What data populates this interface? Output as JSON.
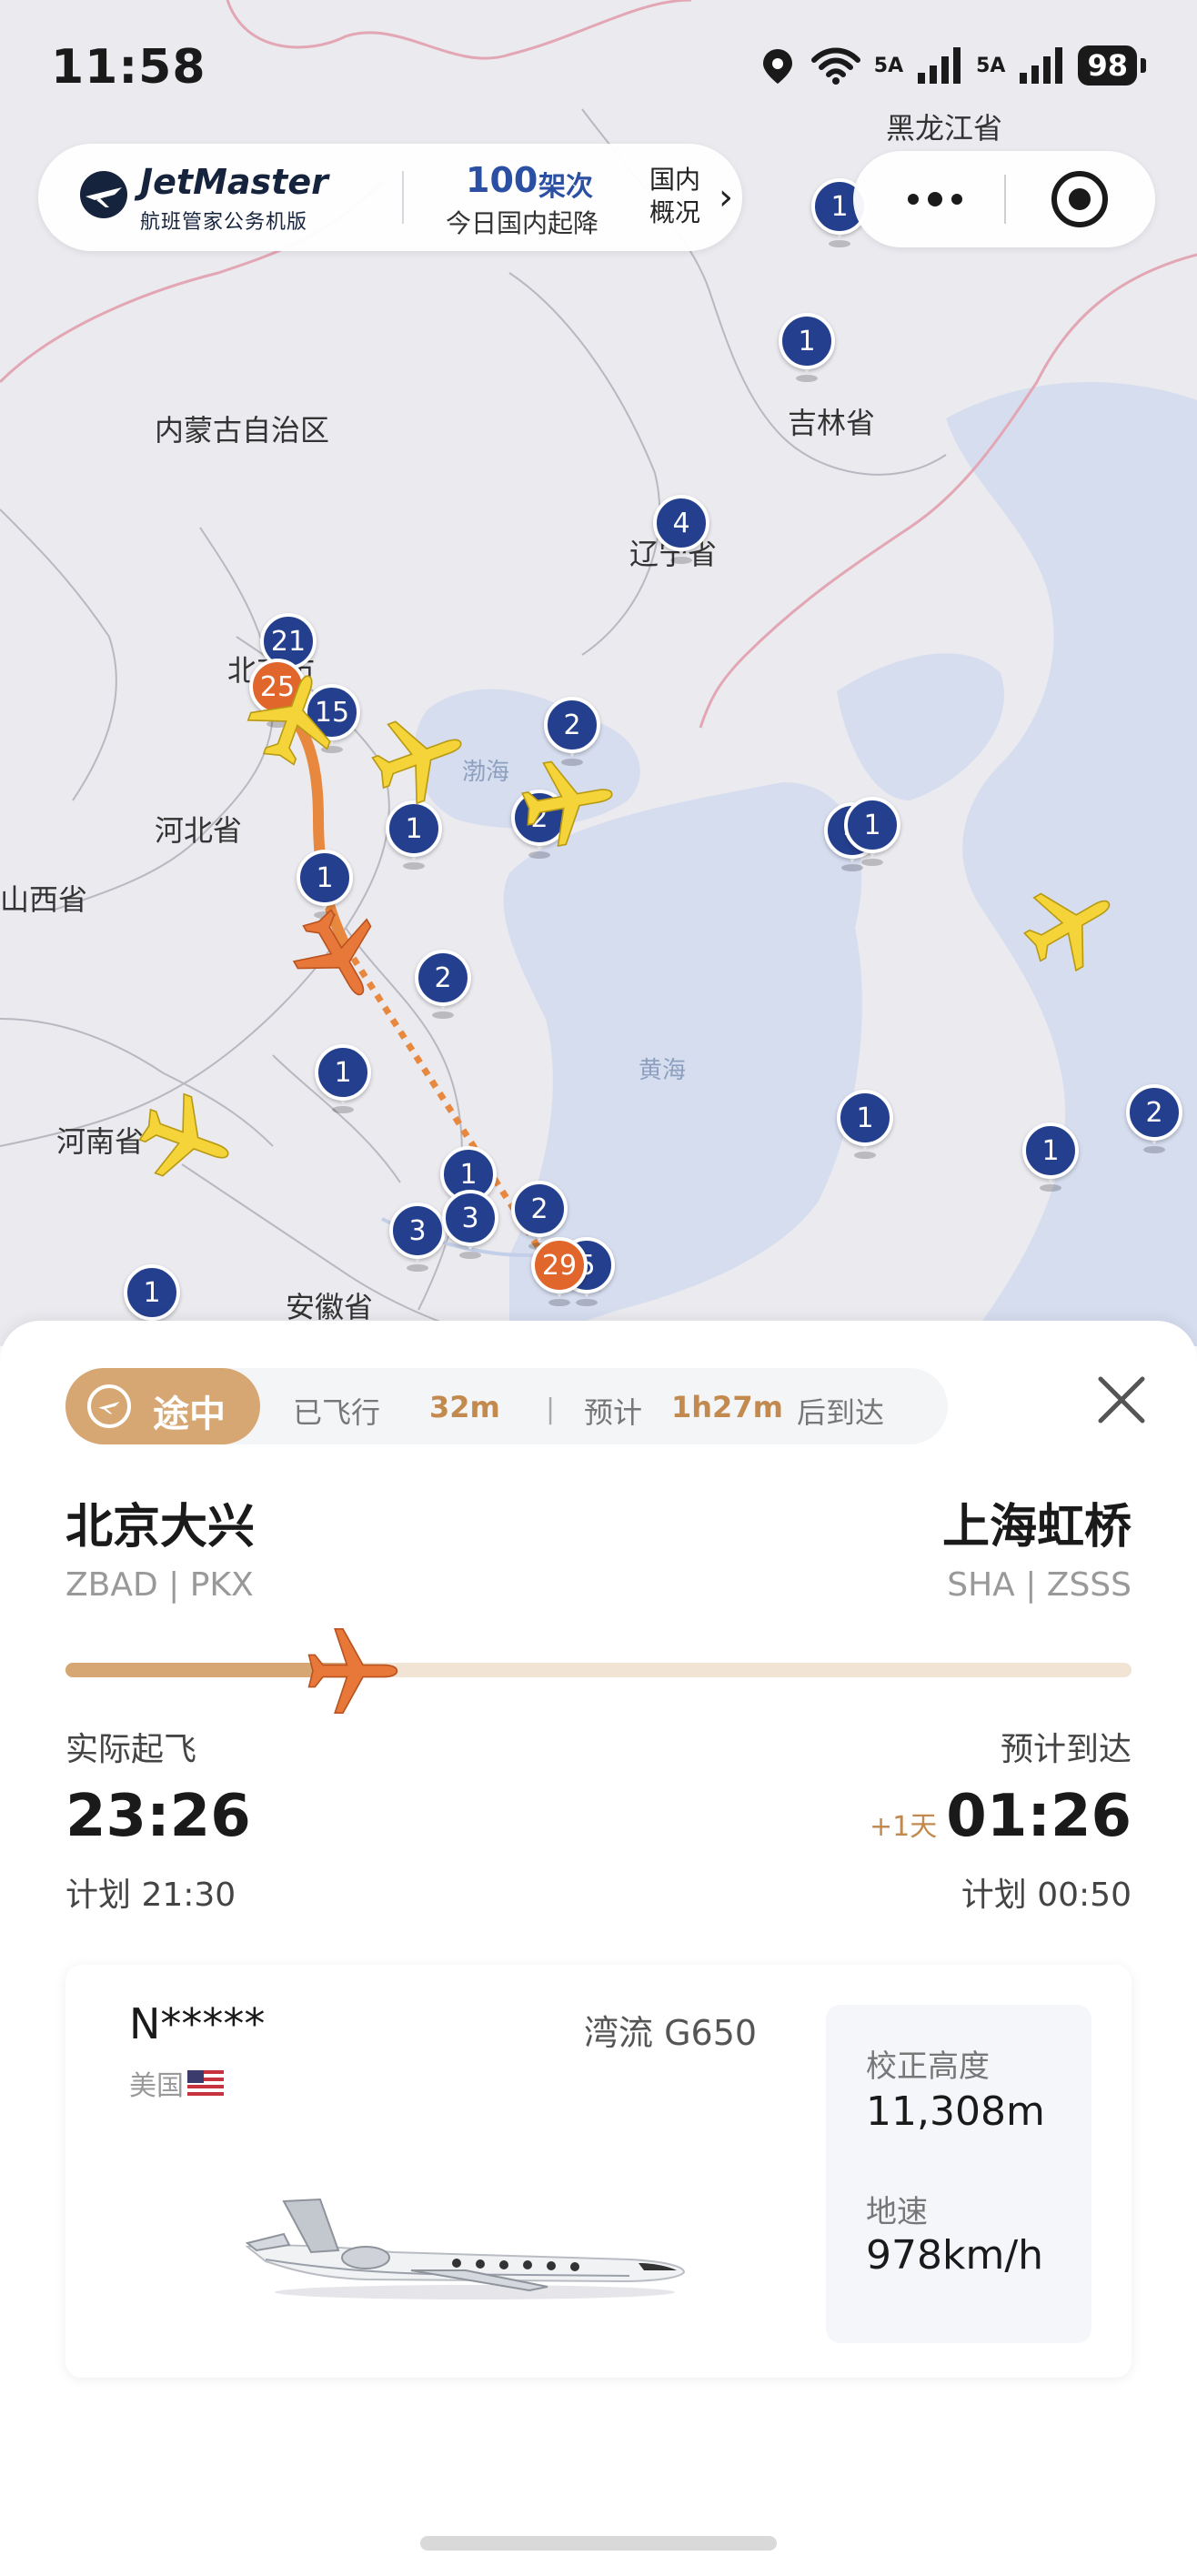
{
  "status_bar": {
    "time": "11:58",
    "net1": "5A",
    "net2": "5A",
    "battery": "98"
  },
  "brand": {
    "name": "JetMaster",
    "subtitle": "航班管家公务机版",
    "count": "100",
    "count_unit": "架次",
    "today": "今日国内起降",
    "domestic": "国内概况",
    "chevron": "›"
  },
  "map": {
    "regions": [
      {
        "id": "heilongjiang",
        "label": "黑龙江省"
      },
      {
        "id": "neimenggu",
        "label": "内蒙古自治区"
      },
      {
        "id": "jilin",
        "label": "吉林省"
      },
      {
        "id": "liaoning",
        "label": "辽宁省"
      },
      {
        "id": "beijing",
        "label": "北京市"
      },
      {
        "id": "hebei",
        "label": "河北省"
      },
      {
        "id": "shanxi",
        "label": "山西省"
      },
      {
        "id": "henan",
        "label": "河南省"
      },
      {
        "id": "anhui",
        "label": "安徽省"
      }
    ],
    "seas": [
      {
        "id": "bohai",
        "label": "渤海"
      },
      {
        "id": "huanghai",
        "label": "黄海"
      }
    ],
    "pins": [
      "1",
      "1",
      "4",
      "21",
      "25",
      "15",
      "2",
      "2",
      "1",
      "4",
      "1",
      "1",
      "2",
      "1",
      "1",
      "3",
      "3",
      "2",
      "29",
      "5",
      "1",
      "1",
      "2",
      "1"
    ]
  },
  "flight": {
    "status": "途中",
    "flown_label": "已飞行",
    "flown_value": "32m",
    "sep": "|",
    "eta_label": "预计",
    "eta_value": "1h27m",
    "eta_suffix": "后到达",
    "progress": 0.27,
    "origin": {
      "name": "北京大兴",
      "code": "ZBAD | PKX"
    },
    "destination": {
      "name": "上海虹桥",
      "code": "SHA | ZSSS"
    },
    "departure": {
      "label": "实际起飞",
      "time": "23:26",
      "plan": "计划 21:30"
    },
    "arrival": {
      "label": "预计到达",
      "plus_day": "+1天",
      "time": "01:26",
      "plan": "计划 00:50"
    }
  },
  "aircraft": {
    "registration": "N*****",
    "country": "美国",
    "model": "湾流 G650",
    "altitude_label": "校正高度",
    "altitude_value": "11,308m",
    "speed_label": "地速",
    "speed_value": "978km/h"
  },
  "colors": {
    "accent": "#d6a673",
    "accent_text": "#c38a4f",
    "pin_blue": "#243f8e",
    "pin_orange": "#e0662c",
    "plane_yellow": "#f5d43a",
    "plane_orange": "#e8773a"
  }
}
